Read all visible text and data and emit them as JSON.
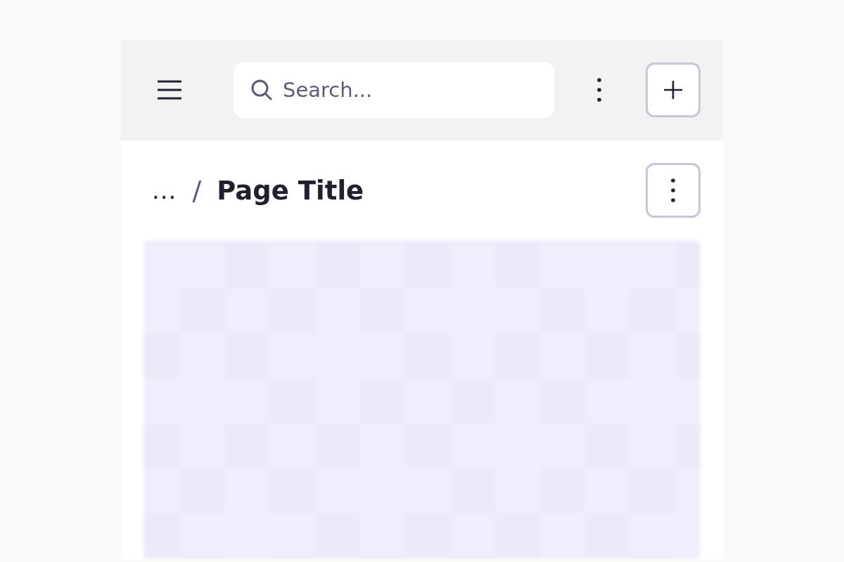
{
  "header": {
    "search": {
      "placeholder": "Search..."
    }
  },
  "breadcrumb": {
    "ellipsis": "...",
    "separator": "/",
    "title": "Page Title"
  },
  "content": {
    "kind": "placeholder"
  }
}
